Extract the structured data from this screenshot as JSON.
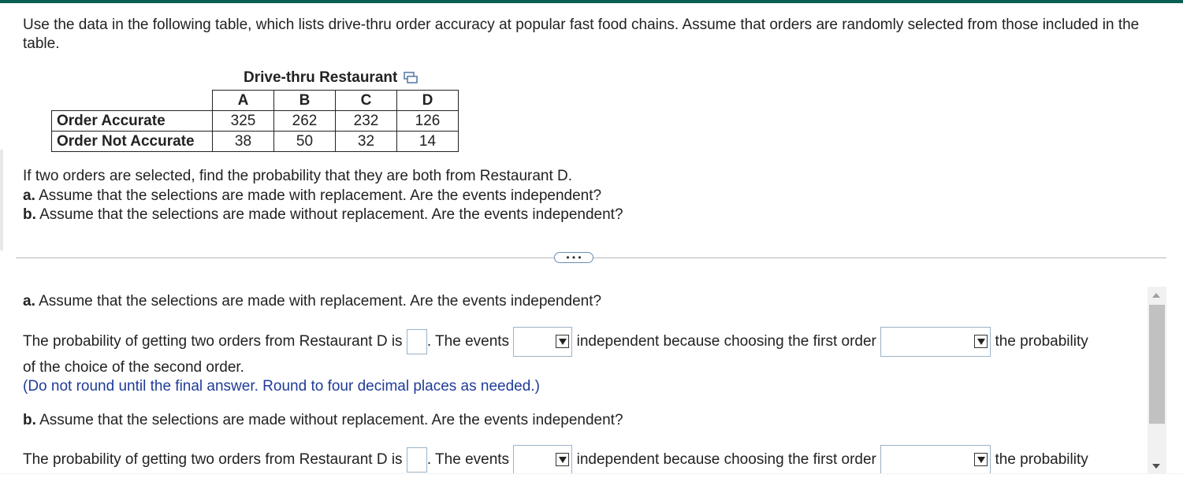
{
  "intro": "Use the data in the following table, which lists drive-thru order accuracy at popular fast food chains. Assume that orders are randomly selected from those included in the table.",
  "table": {
    "caption": "Drive-thru Restaurant",
    "copy_icon": "copy-icon",
    "columns": [
      "A",
      "B",
      "C",
      "D"
    ],
    "rows": [
      {
        "label": "Order Accurate",
        "values": [
          "325",
          "262",
          "232",
          "126"
        ]
      },
      {
        "label": "Order Not Accurate",
        "values": [
          "38",
          "50",
          "32",
          "14"
        ]
      }
    ]
  },
  "question": {
    "stem": "If two orders are selected, find the probability that they are both from Restaurant D.",
    "a_label": "a.",
    "a_text": "Assume that the selections are made with replacement. Are the events independent?",
    "b_label": "b.",
    "b_text": "Assume that the selections are made without replacement. Are the events independent?"
  },
  "more_button": "• • •",
  "answer": {
    "a_label": "a.",
    "a_heading": "Assume that the selections are made with replacement. Are the events independent?",
    "a_prefix": "The probability of getting two orders from Restaurant D is",
    "a_events": ". The events",
    "a_independent": "independent because choosing the first order",
    "a_probability": "the probability",
    "a_continuation": "of the choice of the second order.",
    "note": "(Do not round until the final answer. Round to four decimal places as needed.)",
    "b_label": "b.",
    "b_heading": "Assume that the selections are made without replacement. Are the events independent?",
    "b_prefix": "The probability of getting two orders from Restaurant D is",
    "b_events": ". The events",
    "b_independent": "independent because choosing the first order",
    "b_probability": "the probability"
  },
  "colors": {
    "topbar": "#0b5f52",
    "note": "#1f3c97",
    "input_border": "#9bb2c8"
  }
}
